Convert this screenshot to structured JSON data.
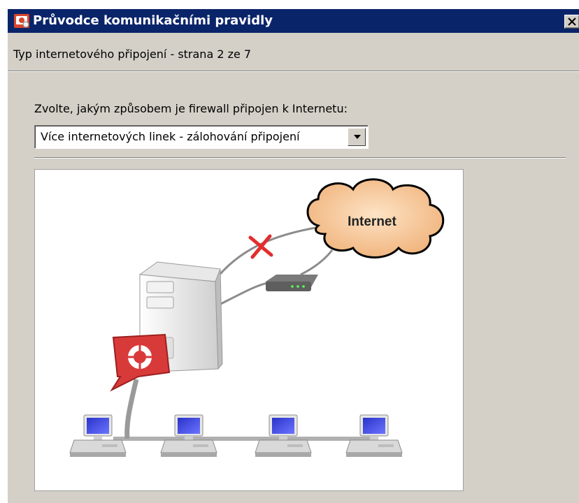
{
  "window": {
    "title": "Průvodce komunikačními pravidly",
    "subtitle": "Typ internetového připojení - strana 2 ze 7"
  },
  "form": {
    "prompt": "Zvolte, jakým způsobem je firewall připojen k Internetu:",
    "connection_type": {
      "selected": "Více internetových linek - zálohování připojení"
    }
  },
  "diagram": {
    "cloud_label": "Internet",
    "primary_link_status": "failed",
    "colors": {
      "cloud": "#f3c08a",
      "failure_mark": "#e32d2d",
      "badge": "#d83a3a",
      "screen": "#3b43d6"
    },
    "icons": [
      "internet-cloud",
      "firewall-server",
      "router",
      "firewall-badge",
      "workstation"
    ]
  }
}
